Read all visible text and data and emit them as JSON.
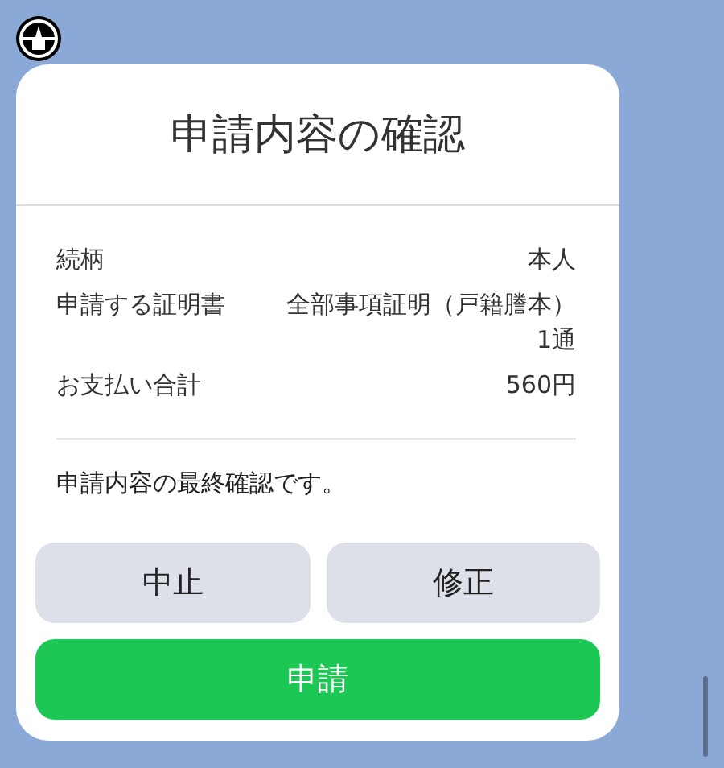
{
  "dialog": {
    "title": "申請内容の確認",
    "rows": [
      {
        "label": "続柄",
        "value": "本人"
      },
      {
        "label": "申請する証明書",
        "value": "全部事項証明（戸籍謄本）1通"
      },
      {
        "label": "お支払い合計",
        "value": "560円"
      }
    ],
    "message": "申請内容の最終確認です。",
    "buttons": [
      {
        "label": "中止",
        "kind": "secondary"
      },
      {
        "label": "修正",
        "kind": "secondary"
      },
      {
        "label": "申請",
        "kind": "primary"
      }
    ]
  }
}
